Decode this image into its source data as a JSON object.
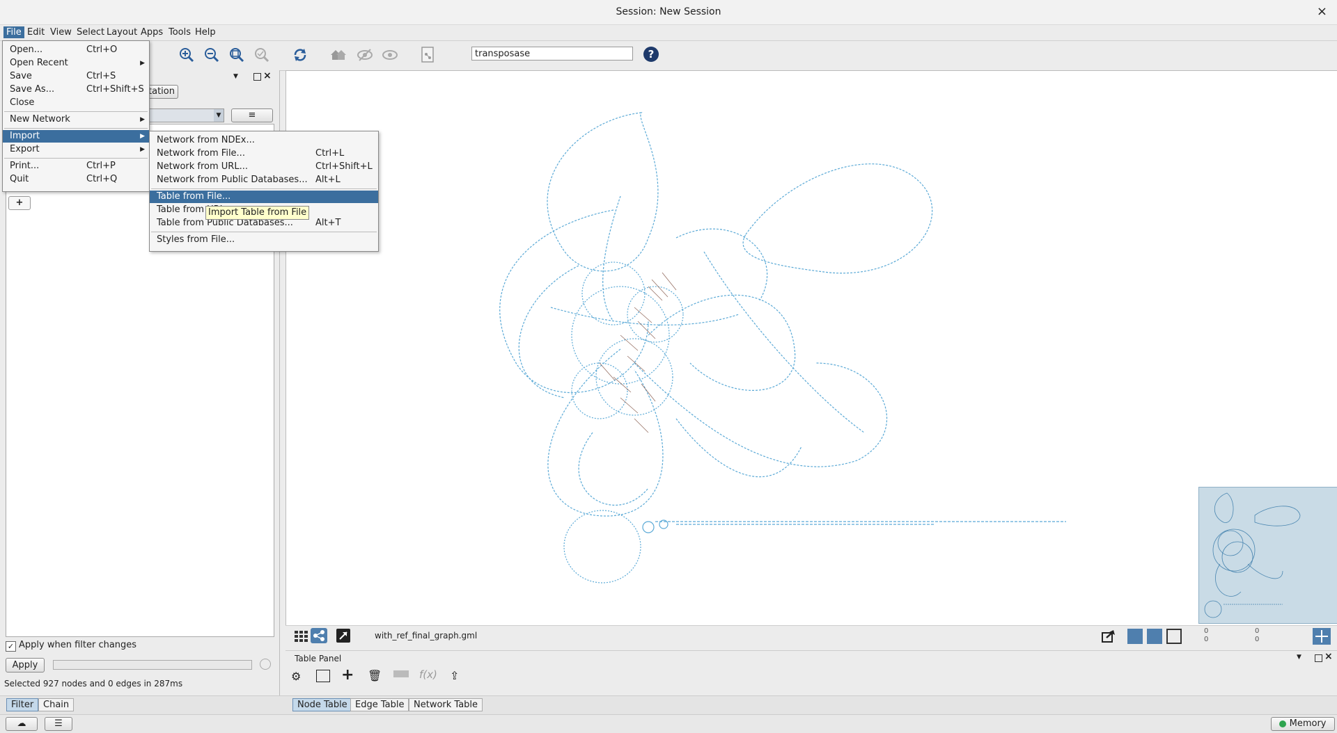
{
  "window": {
    "title": "Session: New Session",
    "close": "×"
  },
  "menubar": [
    "File",
    "Edit",
    "View",
    "Select",
    "Layout",
    "Apps",
    "Tools",
    "Help"
  ],
  "toolbar": {
    "search_value": "transposase",
    "help": "?"
  },
  "left_panel": {
    "tab_button": "tation",
    "apply_when_label": "Apply when filter changes",
    "apply_checked": true,
    "apply_button": "Apply",
    "status": "Selected 927 nodes and 0 edges in 287ms",
    "add_button": "+"
  },
  "file_menu": [
    {
      "label": "Open...",
      "shortcut": "Ctrl+O"
    },
    {
      "label": "Open Recent",
      "submenu": true
    },
    {
      "label": "Save",
      "shortcut": "Ctrl+S"
    },
    {
      "label": "Save As...",
      "shortcut": "Ctrl+Shift+S"
    },
    {
      "label": "Close"
    },
    {
      "label": "New Network",
      "submenu": true
    },
    {
      "label": "Import",
      "submenu": true,
      "highlighted": true
    },
    {
      "label": "Export",
      "submenu": true
    },
    {
      "label": "Print...",
      "shortcut": "Ctrl+P"
    },
    {
      "label": "Quit",
      "shortcut": "Ctrl+Q"
    }
  ],
  "import_menu": [
    {
      "label": "Network from NDEx..."
    },
    {
      "label": "Network from File...",
      "shortcut": "Ctrl+L"
    },
    {
      "label": "Network from URL...",
      "shortcut": "Ctrl+Shift+L"
    },
    {
      "label": "Network from Public Databases...",
      "shortcut": "Alt+L"
    },
    {
      "label": "Table from File...",
      "highlighted": true
    },
    {
      "label": "Table from URL..."
    },
    {
      "label": "Table from Public Databases...",
      "shortcut": "Alt+T"
    },
    {
      "label": "Styles from File..."
    }
  ],
  "tooltip": "Import Table from File",
  "network_view": {
    "filename": "with_ref_final_graph.gml",
    "sel_counts": [
      "0",
      "0",
      "0",
      "0"
    ]
  },
  "table_panel": {
    "title": "Table Panel"
  },
  "bottom_tabs_left": [
    "Filter",
    "Chain"
  ],
  "bottom_tabs_right": [
    "Node Table",
    "Edge Table",
    "Network Table"
  ],
  "status": {
    "memory": "Memory"
  },
  "colors": {
    "accent": "#3b6e9e",
    "edge": "#5aa9d6",
    "edge_dark": "#7a4a3a"
  }
}
